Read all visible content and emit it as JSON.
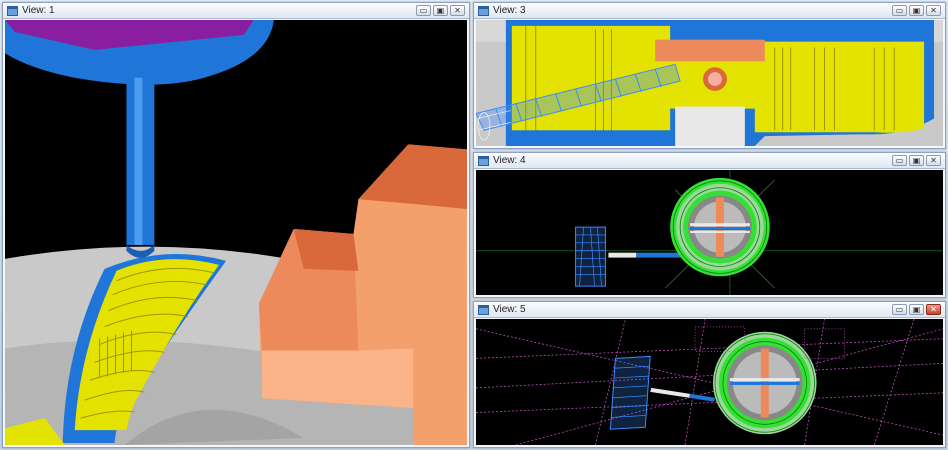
{
  "views": [
    {
      "title": "View: 1",
      "controls": [
        "▭",
        "▣",
        "✕"
      ]
    },
    {
      "title": "View: 3",
      "controls": [
        "▭",
        "▣",
        "✕"
      ]
    },
    {
      "title": "View: 4",
      "controls": [
        "▭",
        "▣",
        "✕"
      ]
    },
    {
      "title": "View: 5",
      "controls": [
        "▭",
        "▣",
        "✕"
      ]
    }
  ],
  "colors": {
    "tool_blue": "#1f76d8",
    "spindle_purple": "#8a1ea0",
    "part_yellow": "#e4e200",
    "stock_orange": "#ec8a5c",
    "toolpath_green": "#35e035",
    "wire_magenta": "#c34fc3"
  },
  "icons": {
    "window": "window-icon",
    "minimize": "minimize-icon",
    "maximize": "maximize-icon",
    "close": "close-icon"
  }
}
